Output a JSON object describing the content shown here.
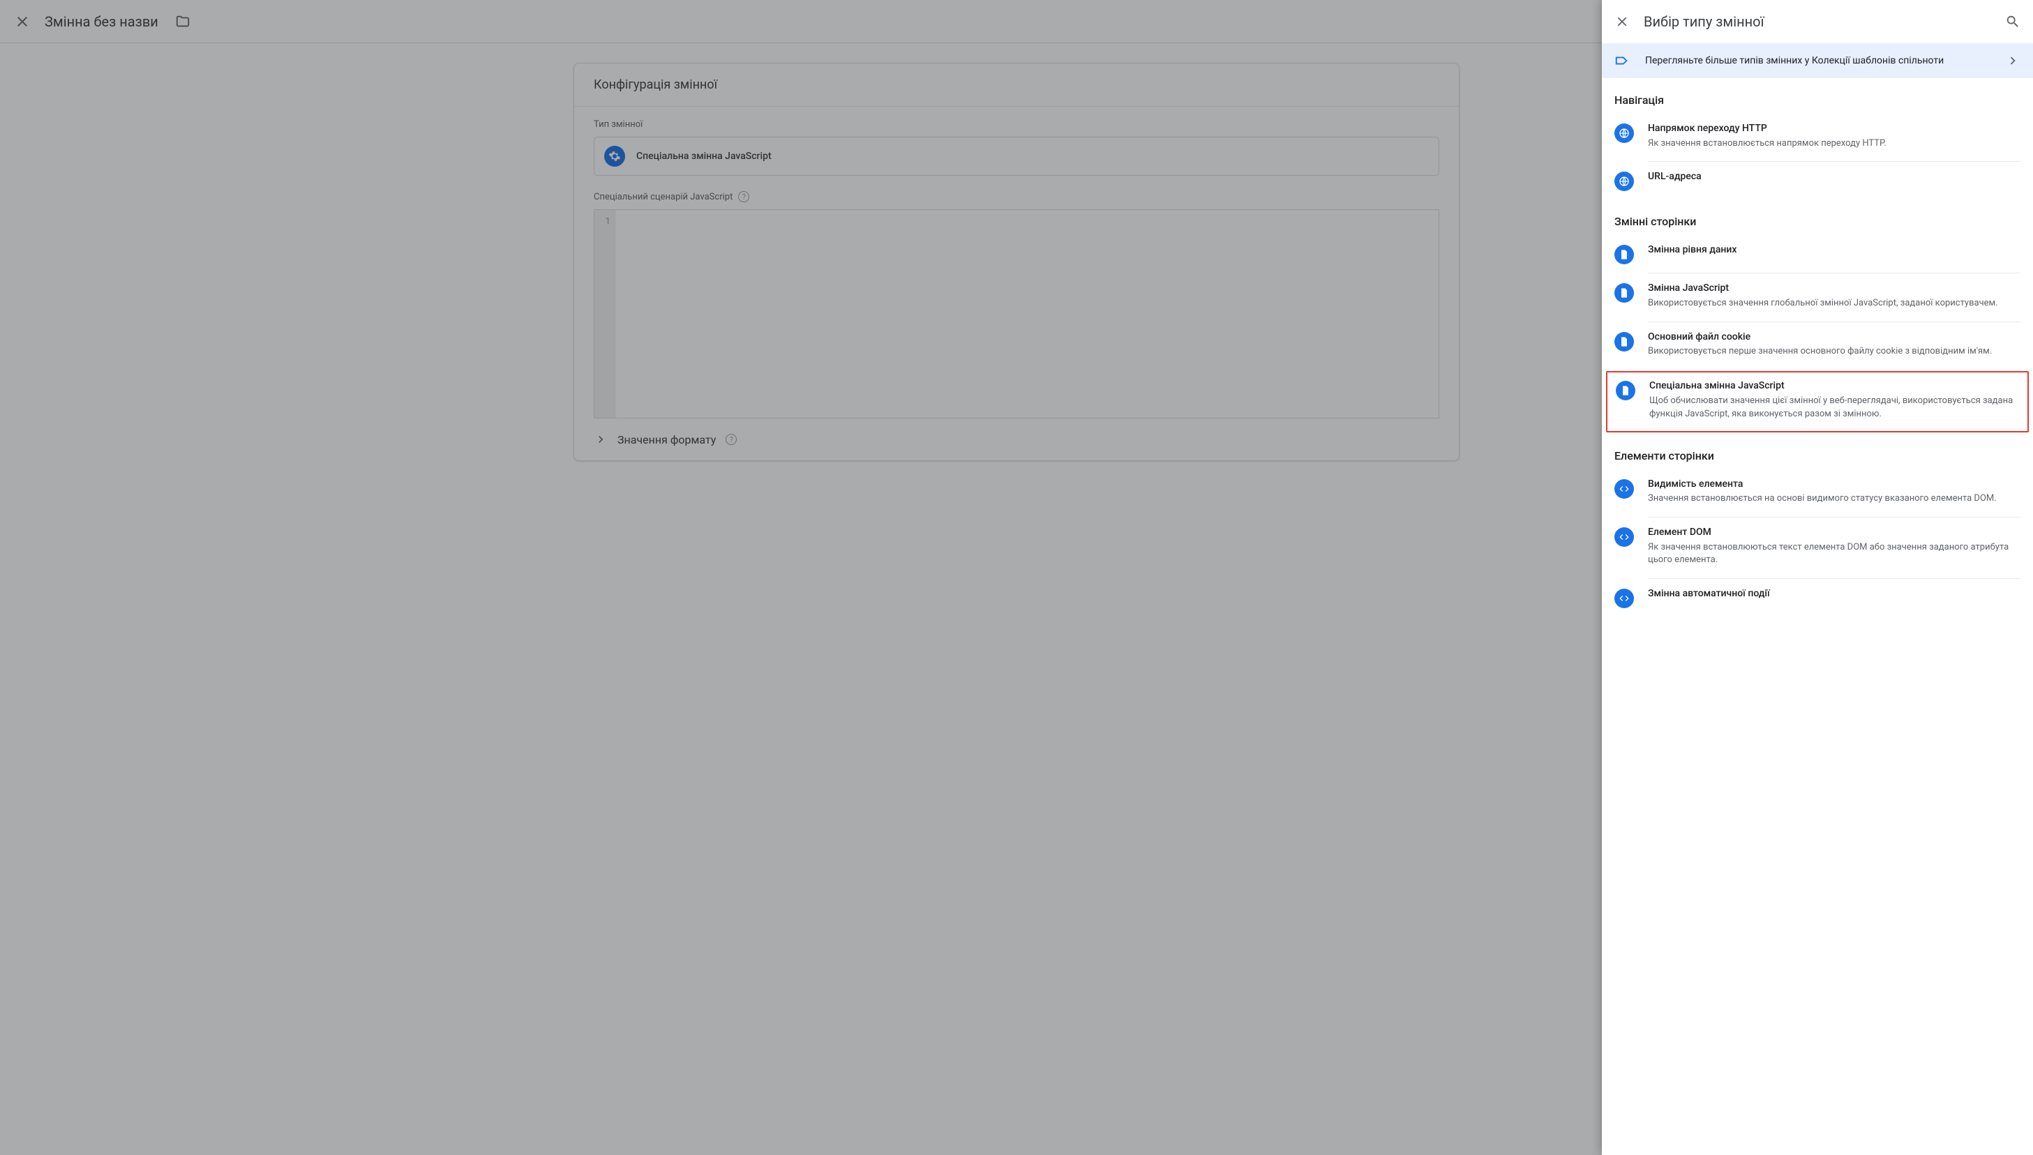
{
  "left": {
    "title": "Змінна без назви",
    "card_header": "Конфігурація змінної",
    "type_label": "Тип змінної",
    "selected_type": "Спеціальна змінна JavaScript",
    "script_label": "Спеціальний сценарій JavaScript",
    "gutter_line": "1",
    "format_label": "Значення формату"
  },
  "panel": {
    "title": "Вибір типу змінної",
    "banner": "Перегляньте більше типів змінних у Колекції шаблонів спільноти",
    "groups": [
      {
        "title": "Навігація",
        "items": [
          {
            "icon": "globe",
            "title": "Напрямок переходу HTTP",
            "desc": "Як значення встановлюється напрямок переходу HTTP."
          },
          {
            "icon": "globe",
            "title": "URL-адреса",
            "desc": ""
          }
        ]
      },
      {
        "title": "Змінні сторінки",
        "items": [
          {
            "icon": "page",
            "title": "Змінна рівня даних",
            "desc": ""
          },
          {
            "icon": "page",
            "title": "Змінна JavaScript",
            "desc": "Використовується значення глобальної змінної JavaScript, заданої користувачем."
          },
          {
            "icon": "page",
            "title": "Основний файл cookie",
            "desc": "Використовується перше значення основного файлу cookie з відповідним ім'ям."
          },
          {
            "icon": "page",
            "title": "Спеціальна змінна JavaScript",
            "desc": "Щоб обчислювати значення цієї змінної у веб-переглядачі, використовується задана функція JavaScript, яка виконується разом зі змінною.",
            "highlight": true
          }
        ]
      },
      {
        "title": "Елементи сторінки",
        "items": [
          {
            "icon": "code",
            "title": "Видимість елемента",
            "desc": "Значення встановлюється на основі видимого статусу вказаного елемента DOM."
          },
          {
            "icon": "code",
            "title": "Елемент DOM",
            "desc": "Як значення встановлюються текст елемента DOM або значення заданого атрибута цього елемента."
          },
          {
            "icon": "code",
            "title": "Змінна автоматичної події",
            "desc": ""
          }
        ]
      }
    ]
  }
}
